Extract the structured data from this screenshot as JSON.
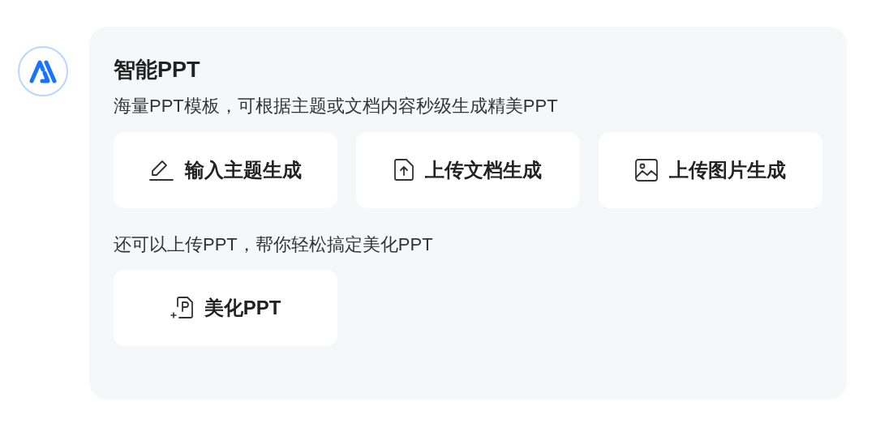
{
  "title": "智能PPT",
  "subtitle": "海量PPT模板，可根据主题或文档内容秒级生成精美PPT",
  "actions": [
    {
      "label": "输入主题生成",
      "kind": "pencil"
    },
    {
      "label": "上传文档生成",
      "kind": "upload"
    },
    {
      "label": "上传图片生成",
      "kind": "image"
    }
  ],
  "hint": "还可以上传PPT，帮你轻松搞定美化PPT",
  "extra_actions": [
    {
      "label": "美化PPT",
      "kind": "ppt"
    }
  ]
}
